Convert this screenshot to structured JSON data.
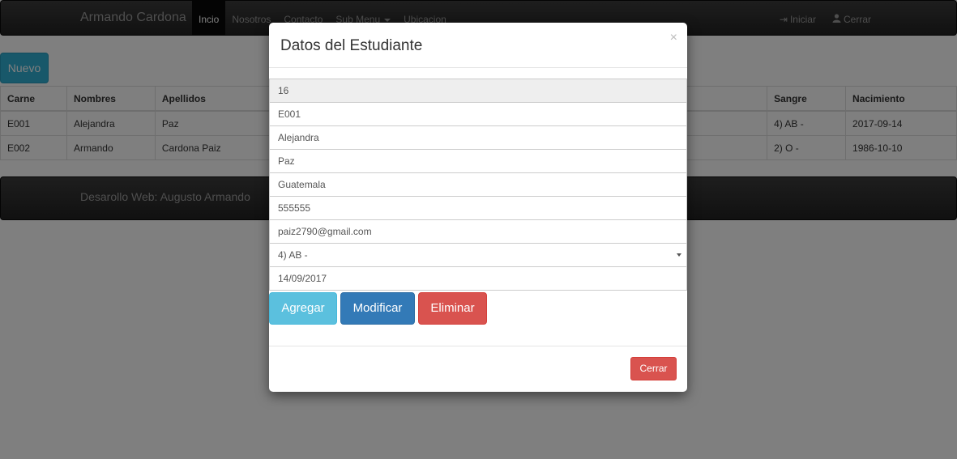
{
  "navbar": {
    "brand": "Armando Cardona",
    "items": [
      {
        "label": "Incio",
        "active": true
      },
      {
        "label": "Nosotros"
      },
      {
        "label": "Contacto"
      },
      {
        "label": "Sub Menu"
      },
      {
        "label": "Ubicacion"
      }
    ],
    "right": [
      {
        "icon": "log-in-icon",
        "label": "Iniciar"
      },
      {
        "icon": "user-icon",
        "label": "Cerrar"
      }
    ]
  },
  "toolbar": {
    "new_label": "Nuevo"
  },
  "table": {
    "headers": [
      "Carne",
      "Nombres",
      "Apellidos",
      "Sangre",
      "Nacimiento"
    ],
    "rows": [
      [
        "E001",
        "Alejandra",
        "Paz",
        "4) AB -",
        "2017-09-14"
      ],
      [
        "E002",
        "Armando",
        "Cardona Paiz",
        "2) O -",
        "1986-10-10"
      ]
    ]
  },
  "footer": {
    "text": "Desarollo Web: Augusto Armando"
  },
  "modal": {
    "title": "Datos del Estudiante",
    "close_symbol": "×",
    "fields": {
      "id": "16",
      "carne": "E001",
      "nombres": "Alejandra",
      "apellidos": "Paz",
      "direccion": "Guatemala",
      "telefono": "555555",
      "correo": "paiz2790@gmail.com",
      "sangre": "4) AB -",
      "nacimiento": "14/09/2017"
    },
    "buttons": {
      "add": "Agregar",
      "update": "Modificar",
      "delete": "Eliminar"
    },
    "close_label": "Cerrar"
  },
  "colors": {
    "info": "#5bc0de",
    "primary": "#337ab7",
    "danger": "#d9534f",
    "navbar": "#222222"
  }
}
